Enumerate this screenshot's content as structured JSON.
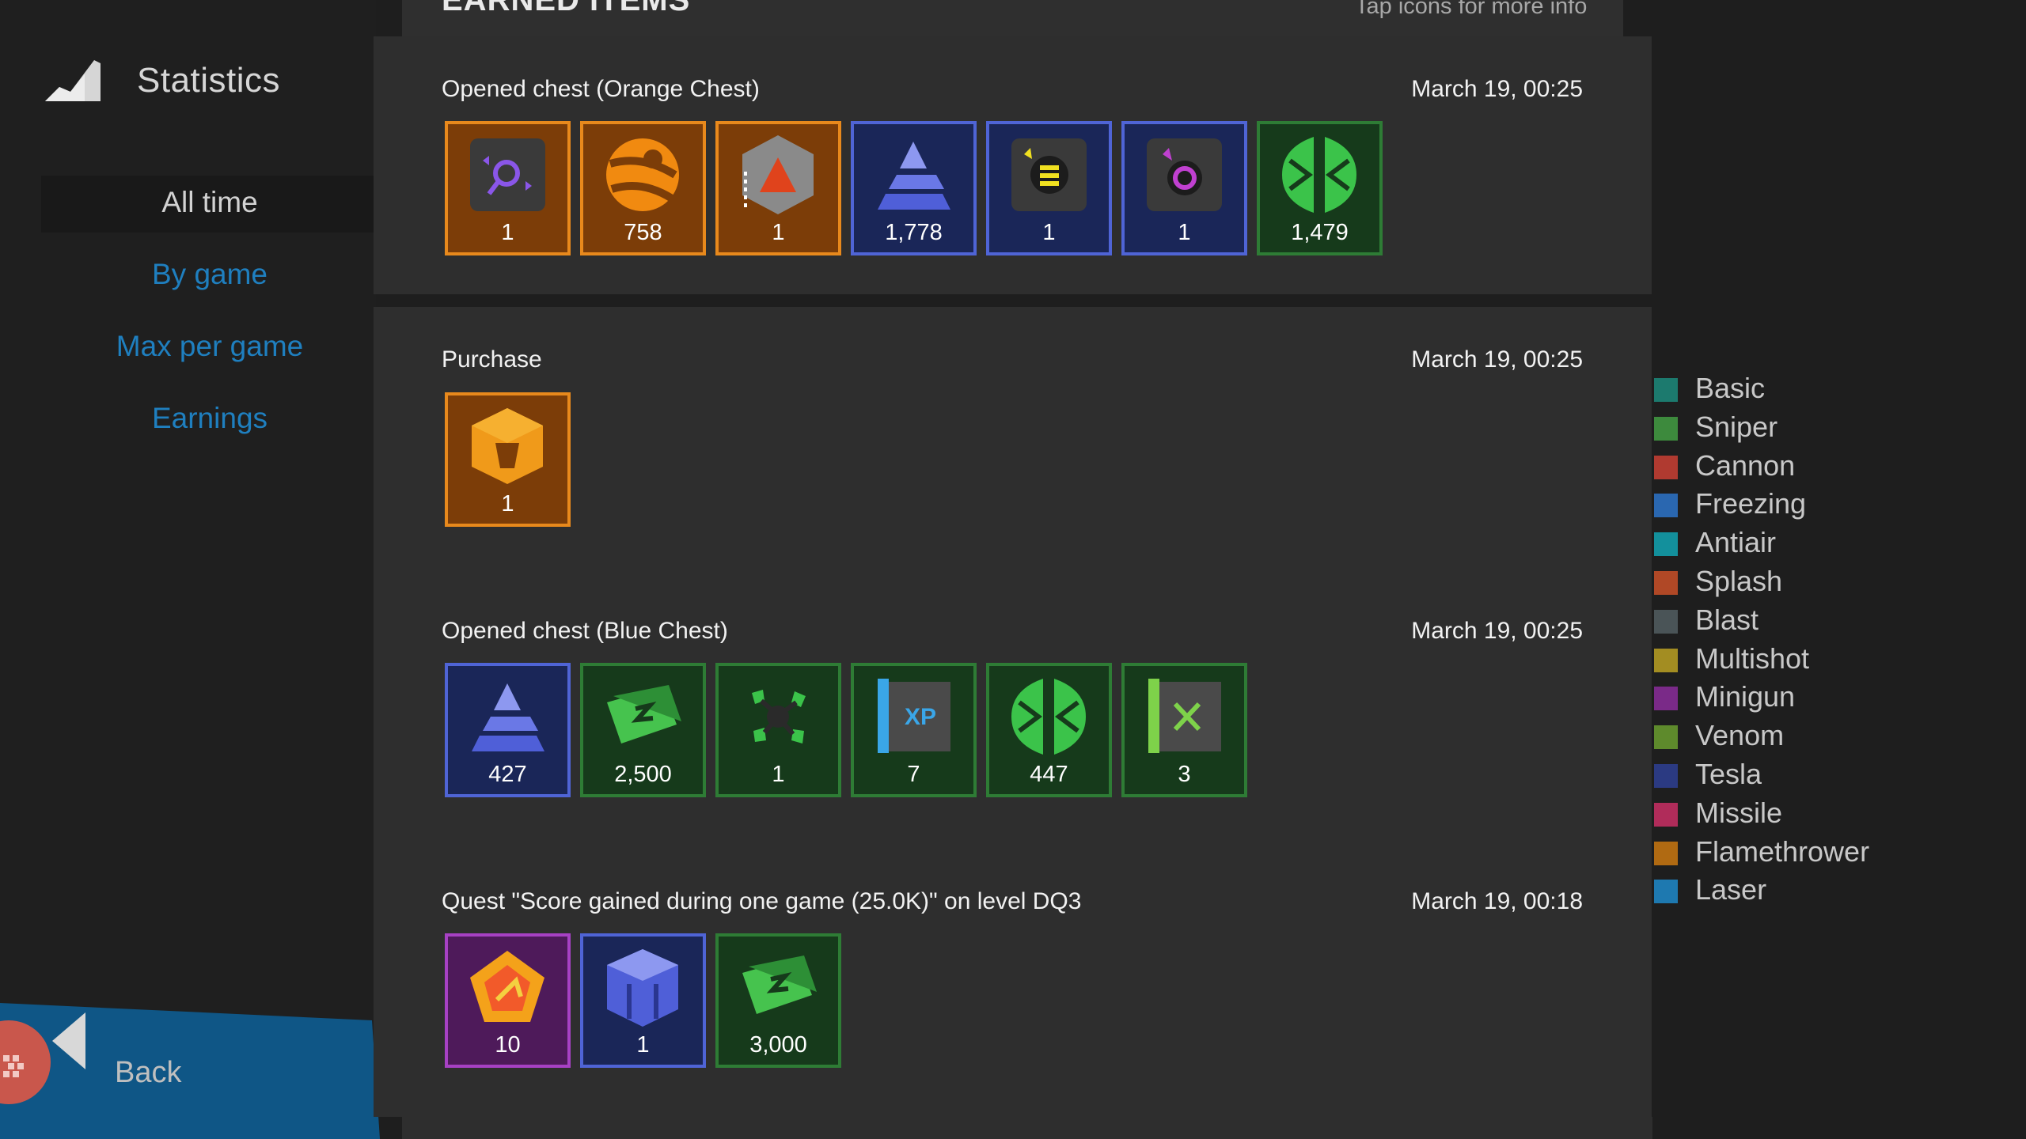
{
  "sidebar": {
    "title": "Statistics",
    "nav": [
      "All time",
      "By game",
      "Max per game",
      "Earnings"
    ],
    "back_label": "Back"
  },
  "header": {
    "title": "EARNED ITEMS",
    "hint": "Tap icons for more info"
  },
  "entries": [
    {
      "title": "Opened chest (Orange Chest)",
      "date": "March 19, 00:25",
      "items": [
        {
          "count": "1",
          "rarity": "orange",
          "icon": "augment-module-icon"
        },
        {
          "count": "758",
          "rarity": "orange",
          "icon": "research-tokens-icon"
        },
        {
          "count": "1",
          "rarity": "orange",
          "icon": "cannon-tower-blueprint-icon"
        },
        {
          "count": "1,778",
          "rarity": "blue",
          "icon": "tesla-shards-icon"
        },
        {
          "count": "1",
          "rarity": "blue",
          "icon": "coin-module-icon"
        },
        {
          "count": "1",
          "rarity": "blue",
          "icon": "minigun-module-icon"
        },
        {
          "count": "1,479",
          "rarity": "green",
          "icon": "green-crystals-icon"
        }
      ]
    },
    {
      "title": "Purchase",
      "date": "March 19, 00:25",
      "items": [
        {
          "count": "1",
          "rarity": "orange",
          "icon": "orange-chest-icon"
        }
      ]
    },
    {
      "title": "Opened chest (Blue Chest)",
      "date": "March 19, 00:25",
      "items": [
        {
          "count": "427",
          "rarity": "blue",
          "icon": "tesla-shards-icon"
        },
        {
          "count": "2,500",
          "rarity": "green",
          "icon": "cash-bills-icon"
        },
        {
          "count": "1",
          "rarity": "green",
          "icon": "venom-ability-icon"
        },
        {
          "count": "7",
          "rarity": "green",
          "icon": "xp-scroll-icon"
        },
        {
          "count": "447",
          "rarity": "green",
          "icon": "green-crystals-icon"
        },
        {
          "count": "3",
          "rarity": "green",
          "icon": "venom-scroll-icon"
        }
      ]
    },
    {
      "title": "Quest \"Score gained during one game (25.0K)\" on level DQ3",
      "date": "March 19, 00:18",
      "items": [
        {
          "count": "10",
          "rarity": "purple",
          "icon": "pentagon-rune-icon"
        },
        {
          "count": "1",
          "rarity": "blue",
          "icon": "blue-chest-icon"
        },
        {
          "count": "3,000",
          "rarity": "green",
          "icon": "cash-bills-icon"
        }
      ]
    }
  ],
  "legend": [
    {
      "label": "Basic",
      "color": "#1c7a6e"
    },
    {
      "label": "Sniper",
      "color": "#3d8a3d"
    },
    {
      "label": "Cannon",
      "color": "#b03a30"
    },
    {
      "label": "Freezing",
      "color": "#2a67b0"
    },
    {
      "label": "Antiair",
      "color": "#13909c"
    },
    {
      "label": "Splash",
      "color": "#b04826"
    },
    {
      "label": "Blast",
      "color": "#4a5457"
    },
    {
      "label": "Multishot",
      "color": "#a38d22"
    },
    {
      "label": "Minigun",
      "color": "#7a2a88"
    },
    {
      "label": "Venom",
      "color": "#5e8a2c"
    },
    {
      "label": "Tesla",
      "color": "#2b3a82"
    },
    {
      "label": "Missile",
      "color": "#b02c5a"
    },
    {
      "label": "Flamethrower",
      "color": "#b06a12"
    },
    {
      "label": "Laser",
      "color": "#1e79b0"
    }
  ]
}
